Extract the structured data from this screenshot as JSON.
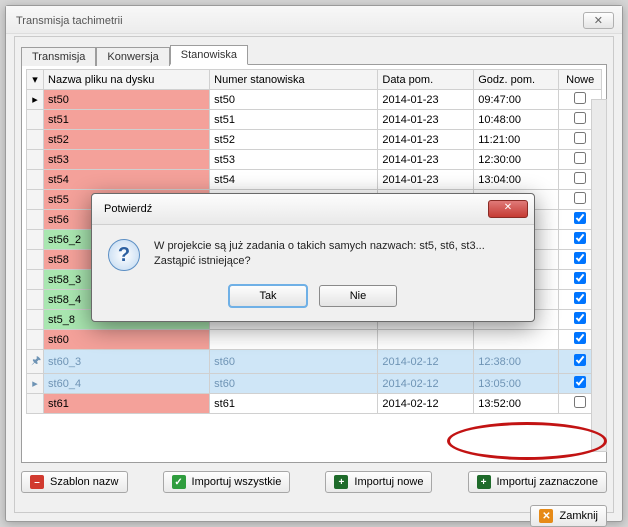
{
  "window": {
    "title": "Transmisja tachimetrii"
  },
  "tabs": [
    {
      "label": "Transmisja",
      "active": false
    },
    {
      "label": "Konwersja",
      "active": false
    },
    {
      "label": "Stanowiska",
      "active": true
    }
  ],
  "grid": {
    "headers": {
      "file": "Nazwa pliku na dysku",
      "station": "Numer stanowiska",
      "date": "Data pom.",
      "time": "Godz. pom.",
      "new": "Nowe"
    },
    "rows": [
      {
        "arrow": "▸",
        "file": "st50",
        "station": "st50",
        "date": "2014-01-23",
        "time": "09:47:00",
        "checked": false,
        "cls": "salmon"
      },
      {
        "file": "st51",
        "station": "st51",
        "date": "2014-01-23",
        "time": "10:48:00",
        "checked": false,
        "cls": "salmon"
      },
      {
        "file": "st52",
        "station": "st52",
        "date": "2014-01-23",
        "time": "11:21:00",
        "checked": false,
        "cls": "salmon"
      },
      {
        "file": "st53",
        "station": "st53",
        "date": "2014-01-23",
        "time": "12:30:00",
        "checked": false,
        "cls": "salmon"
      },
      {
        "file": "st54",
        "station": "st54",
        "date": "2014-01-23",
        "time": "13:04:00",
        "checked": false,
        "cls": "salmon"
      },
      {
        "file": "st55",
        "station": "",
        "date": "",
        "time": "",
        "checked": false,
        "cls": "salmon"
      },
      {
        "file": "st56",
        "station": "",
        "date": "",
        "time": "",
        "checked": true,
        "cls": "salmon"
      },
      {
        "file": "st56_2",
        "station": "",
        "date": "",
        "time": "",
        "checked": true,
        "cls": "lightgreen"
      },
      {
        "file": "st58",
        "station": "",
        "date": "",
        "time": "",
        "checked": true,
        "cls": "salmon"
      },
      {
        "file": "st58_3",
        "station": "",
        "date": "",
        "time": "",
        "checked": true,
        "cls": "lightgreen"
      },
      {
        "file": "st58_4",
        "station": "",
        "date": "",
        "time": "",
        "checked": true,
        "cls": "lightgreen"
      },
      {
        "file": "st5_8",
        "station": "",
        "date": "",
        "time": "",
        "checked": true,
        "cls": "lightgreen"
      },
      {
        "file": "st60",
        "station": "",
        "date": "",
        "time": "",
        "checked": true,
        "cls": "salmon"
      },
      {
        "arrow": "🖈",
        "file": "st60_3",
        "station": "st60",
        "date": "2014-02-12",
        "time": "12:38:00",
        "checked": true,
        "cls": "sel"
      },
      {
        "arrow": "▸",
        "file": "st60_4",
        "station": "st60",
        "date": "2014-02-12",
        "time": "13:05:00",
        "checked": true,
        "cls": "sel"
      },
      {
        "file": "st61",
        "station": "st61",
        "date": "2014-02-12",
        "time": "13:52:00",
        "checked": false,
        "cls": "salmon"
      }
    ]
  },
  "toolbar": {
    "template": "Szablon nazw",
    "import_all": "Importuj wszystkie",
    "import_new": "Importuj nowe",
    "import_selected": "Importuj zaznaczone"
  },
  "bottom": {
    "close": "Zamknij"
  },
  "dialog": {
    "title": "Potwierdź",
    "line1": "W projekcie są już zadania o takich samych nazwach: st5, st6, st3...",
    "line2": "Zastąpić istniejące?",
    "yes": "Tak",
    "no": "Nie"
  }
}
